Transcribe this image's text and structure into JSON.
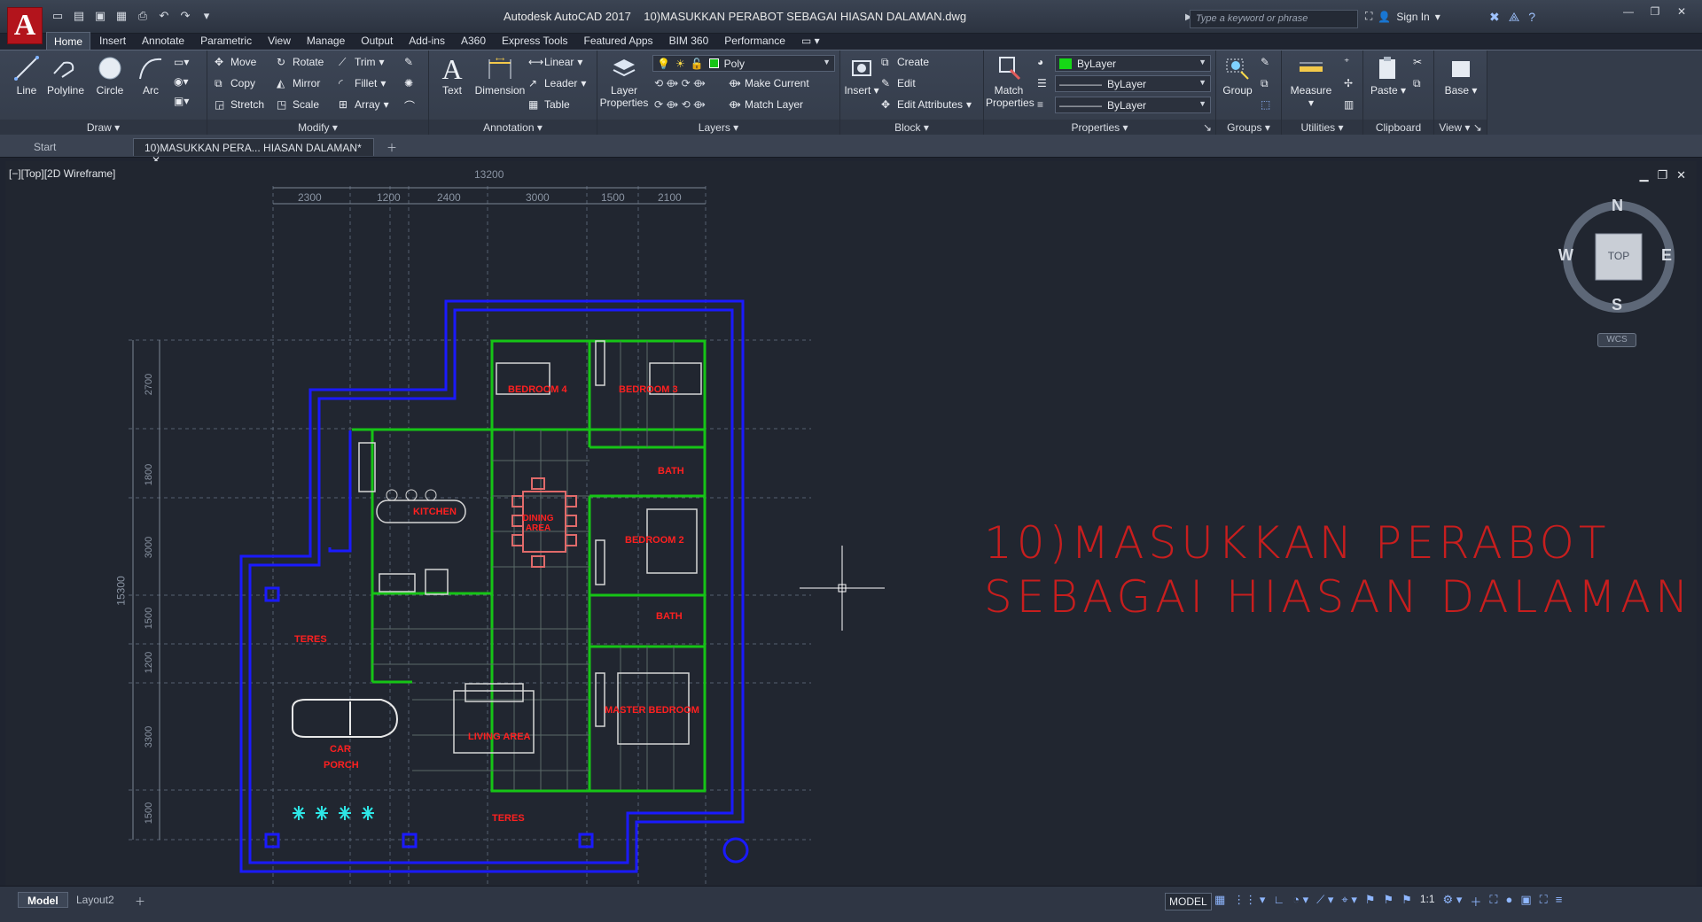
{
  "app": {
    "logo_letter": "A",
    "title": "Autodesk AutoCAD 2017",
    "file_title": "10)MASUKKAN PERABOT SEBAGAI HIASAN DALAMAN.dwg",
    "search_placeholder": "Type a keyword or phrase",
    "sign_in": "Sign In"
  },
  "ribbon_tabs": [
    "Home",
    "Insert",
    "Annotate",
    "Parametric",
    "View",
    "Manage",
    "Output",
    "Add-ins",
    "A360",
    "Express Tools",
    "Featured Apps",
    "BIM 360",
    "Performance"
  ],
  "ribbon": {
    "draw": {
      "title": "Draw",
      "line": "Line",
      "polyline": "Polyline",
      "circle": "Circle",
      "arc": "Arc"
    },
    "modify": {
      "title": "Modify",
      "move": "Move",
      "rotate": "Rotate",
      "trim": "Trim",
      "copy": "Copy",
      "mirror": "Mirror",
      "fillet": "Fillet",
      "stretch": "Stretch",
      "scale": "Scale",
      "array": "Array"
    },
    "annotation": {
      "title": "Annotation",
      "text": "Text",
      "dimension": "Dimension",
      "linear": "Linear",
      "leader": "Leader",
      "table": "Table"
    },
    "layers": {
      "title": "Layers",
      "layer_properties_1": "Layer",
      "layer_properties_2": "Properties",
      "current_layer": "Poly",
      "make_current": "Make Current",
      "match_layer": "Match Layer"
    },
    "block": {
      "title": "Block",
      "insert": "Insert",
      "create": "Create",
      "edit": "Edit",
      "edit_attributes": "Edit Attributes"
    },
    "properties": {
      "title": "Properties",
      "match_1": "Match",
      "match_2": "Properties",
      "color": "ByLayer",
      "linetype": "ByLayer",
      "lineweight": "ByLayer"
    },
    "groups": {
      "title": "Groups",
      "group": "Group"
    },
    "utilities": {
      "title": "Utilities",
      "measure": "Measure"
    },
    "clipboard": {
      "title": "Clipboard",
      "paste": "Paste"
    },
    "view": {
      "title": "View",
      "base": "Base"
    }
  },
  "doc_tabs": {
    "start": "Start",
    "active": "10)MASUKKAN PERA... HIASAN DALAMAN*"
  },
  "viewport": {
    "label": "[−][Top][2D Wireframe]",
    "compass": {
      "n": "N",
      "s": "S",
      "e": "E",
      "w": "W",
      "top": "TOP",
      "wcs": "WCS"
    }
  },
  "drawing": {
    "heading_line1": "10)MASUKKAN PERABOT",
    "heading_line2": "SEBAGAI HIASAN DALAMAN",
    "top_total": "13200",
    "top_dims": [
      "2300",
      "1200",
      "2400",
      "3000",
      "1500",
      "2100"
    ],
    "side_total": "15300",
    "side_dims": [
      "2700",
      "1800",
      "3000",
      "1500",
      "1200",
      "3300",
      "1500"
    ],
    "rooms": {
      "bedroom4": "BEDROOM 4",
      "bedroom3": "BEDROOM 3",
      "bath1": "BATH",
      "dining": "DINING AREA",
      "kitchen": "KITCHEN",
      "bedroom2": "BEDROOM 2",
      "bath2": "BATH",
      "teres1": "TERES",
      "master": "MASTER BEDROOM",
      "living": "LIVING AREA",
      "car1": "CAR",
      "car2": "PORCH",
      "teres2": "TERES"
    },
    "colors": {
      "wall_outer": "#1a1aff",
      "wall_inner": "#16c416",
      "furniture": "#d6d6d6",
      "label": "#ff2020",
      "dining_furniture": "#e06a6a"
    }
  },
  "status": {
    "tab_model": "Model",
    "tab_layout": "Layout2",
    "model_button": "MODEL",
    "scale": "1:1"
  }
}
